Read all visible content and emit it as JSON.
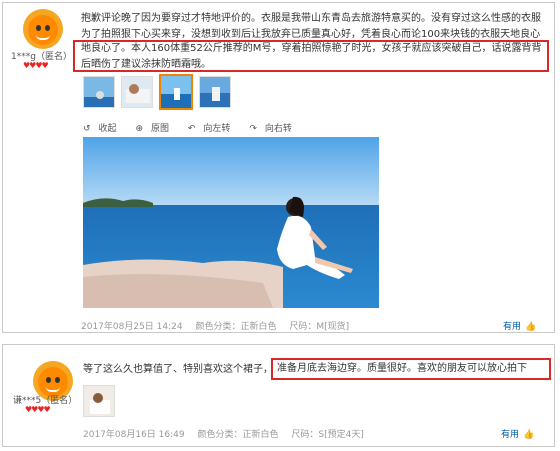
{
  "reviews": [
    {
      "username": "1***g（匿名）",
      "hearts": "♥♥♥♥",
      "text": "抱歉评论晚了因为要穿过才特地评价的。衣服是我带山东青岛去旅游特意买的。没有穿过这么性感的衣服为了拍照狠下心买来穿，没想到收到后让我放弃已质量真心好，凭着良心而论100来块钱的衣服天地良心了。本人160体重52公斤推荐的M号，穿着拍照惊艳了时光，女孩子就应该突破自己，话说露背背后晒伤了建议涂抹防晒霜哦。",
      "highlight": "地良心了。本人160体重52公斤推荐的M号，穿着拍照惊艳了时光，女孩子就应该突破自己，话说露背背后晒伤了建议涂抹防晒霜哦。",
      "toolbar": [
        "收起",
        "原图",
        "向左转",
        "向右转"
      ],
      "date": "2017年08月25日 14:24",
      "color": "颜色分类：正新白色",
      "size": "尺码：M[现货]",
      "useful": "有用"
    },
    {
      "username": "谦***5（匿名）",
      "hearts": "♥♥♥♥",
      "text": "等了这么久也算值了、特别喜欢这个裙子，准备月底去海边穿。质量很好。喜欢的朋友可以放心拍下",
      "highlight": "准备月底去海边穿。质量很好。喜欢的朋友可以放心拍下",
      "date": "2017年08月16日 16:49",
      "color": "颜色分类：正新白色",
      "size": "尺码：S[预定4天]",
      "useful": "有用"
    }
  ],
  "icons": {
    "toolbar": [
      "undo-icon",
      "zoom-icon",
      "rotate-left-icon",
      "rotate-right-icon"
    ],
    "useful": "thumbs-up-icon"
  },
  "colors": {
    "highlight_box": "#d9282a",
    "selected_thumb": "#f08300",
    "useful_link": "#005ea7"
  }
}
